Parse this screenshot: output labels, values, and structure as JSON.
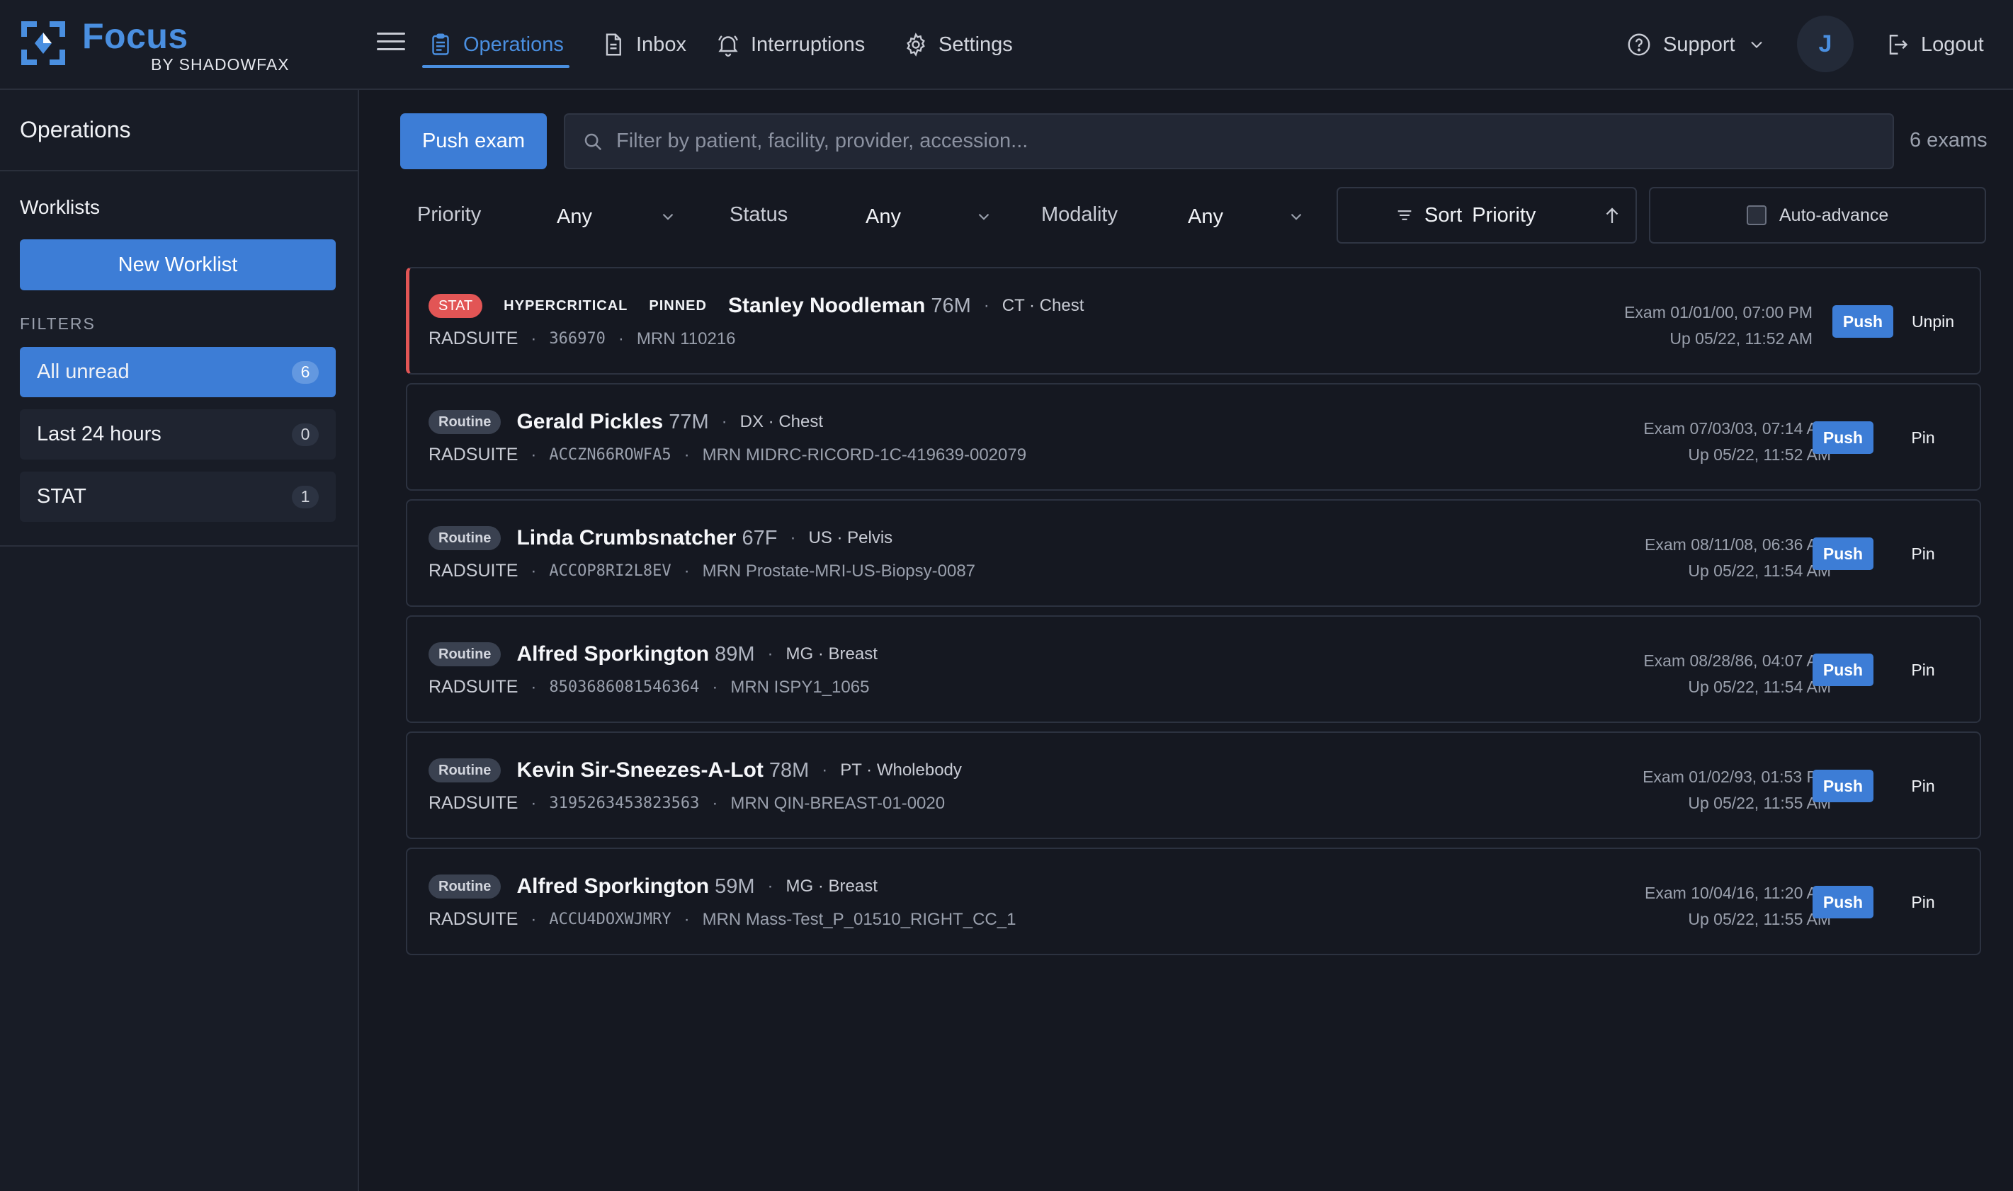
{
  "brand": {
    "name": "Focus",
    "subtitle": "BY SHADOWFAX"
  },
  "nav": {
    "operations": "Operations",
    "inbox": "Inbox",
    "interruptions": "Interruptions",
    "settings": "Settings",
    "support": "Support",
    "avatar_initial": "J",
    "logout": "Logout"
  },
  "sidebar": {
    "title": "Operations",
    "worklists_heading": "Worklists",
    "new_worklist": "New Worklist",
    "filters_heading": "FILTERS",
    "filters": [
      {
        "label": "All unread",
        "count": "6",
        "active": true
      },
      {
        "label": "Last 24 hours",
        "count": "0",
        "active": false
      },
      {
        "label": "STAT",
        "count": "1",
        "active": false
      }
    ]
  },
  "toolbar": {
    "push_exam": "Push exam",
    "search_placeholder": "Filter by patient, facility, provider, accession...",
    "exam_count": "6 exams",
    "priority_label": "Priority",
    "priority_value": "Any",
    "status_label": "Status",
    "status_value": "Any",
    "modality_label": "Modality",
    "modality_value": "Any",
    "sort_prefix": "Sort",
    "sort_value": "Priority",
    "auto_advance": "Auto-advance"
  },
  "exams": [
    {
      "priority": "STAT",
      "tags": [
        "HYPERCRITICAL",
        "PINNED"
      ],
      "name": "Stanley Noodleman",
      "age_sex": "76M",
      "study": "CT · Chest",
      "facility": "RADSUITE",
      "accession": "366970",
      "mrn": "MRN 110216",
      "exam_time": "Exam 01/01/00, 07:00 PM",
      "updated": "Up 05/22, 11:52 AM",
      "push": "Push",
      "pin": "Unpin"
    },
    {
      "priority": "Routine",
      "name": "Gerald Pickles",
      "age_sex": "77M",
      "study": "DX · Chest",
      "facility": "RADSUITE",
      "accession": "ACCZN66ROWFA5",
      "mrn": "MRN MIDRC-RICORD-1C-419639-002079",
      "exam_time": "Exam 07/03/03, 07:14 AM",
      "updated": "Up 05/22, 11:52 AM",
      "push": "Push",
      "pin": "Pin"
    },
    {
      "priority": "Routine",
      "name": "Linda Crumbsnatcher",
      "age_sex": "67F",
      "study": "US · Pelvis",
      "facility": "RADSUITE",
      "accession": "ACCOP8RI2L8EV",
      "mrn": "MRN Prostate-MRI-US-Biopsy-0087",
      "exam_time": "Exam 08/11/08, 06:36 AM",
      "updated": "Up 05/22, 11:54 AM",
      "push": "Push",
      "pin": "Pin"
    },
    {
      "priority": "Routine",
      "name": "Alfred Sporkington",
      "age_sex": "89M",
      "study": "MG · Breast",
      "facility": "RADSUITE",
      "accession": "8503686081546364",
      "mrn": "MRN ISPY1_1065",
      "exam_time": "Exam 08/28/86, 04:07 AM",
      "updated": "Up 05/22, 11:54 AM",
      "push": "Push",
      "pin": "Pin"
    },
    {
      "priority": "Routine",
      "name": "Kevin Sir-Sneezes-A-Lot",
      "age_sex": "78M",
      "study": "PT · Wholebody",
      "facility": "RADSUITE",
      "accession": "3195263453823563",
      "mrn": "MRN QIN-BREAST-01-0020",
      "exam_time": "Exam 01/02/93, 01:53 PM",
      "updated": "Up 05/22, 11:55 AM",
      "push": "Push",
      "pin": "Pin"
    },
    {
      "priority": "Routine",
      "name": "Alfred Sporkington",
      "age_sex": "59M",
      "study": "MG · Breast",
      "facility": "RADSUITE",
      "accession": "ACCU4DOXWJMRY",
      "mrn": "MRN Mass-Test_P_01510_RIGHT_CC_1",
      "exam_time": "Exam 10/04/16, 11:20 AM",
      "updated": "Up 05/22, 11:55 AM",
      "push": "Push",
      "pin": "Pin"
    }
  ],
  "colors": {
    "accent": "#3d7dd6",
    "stat": "#e25555",
    "background": "#151821"
  }
}
